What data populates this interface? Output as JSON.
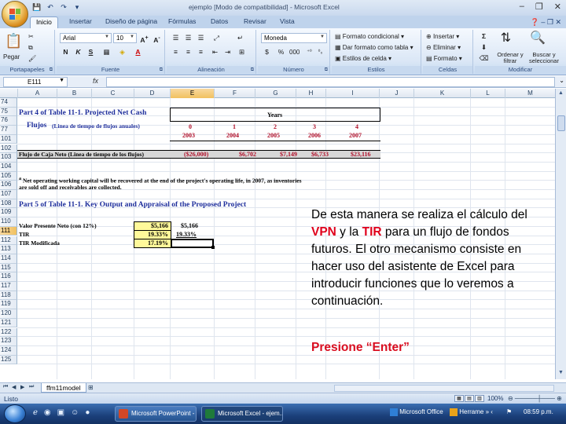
{
  "window": {
    "title": "ejemplo  [Modo de compatibilidad] - Microsoft Excel",
    "controls": [
      "–",
      "❐",
      "✕"
    ]
  },
  "qat": [
    "💾",
    "↶",
    "↷",
    "▾"
  ],
  "ribbon": {
    "tabs": [
      "Inicio",
      "Insertar",
      "Diseño de página",
      "Fórmulas",
      "Datos",
      "Revisar",
      "Vista"
    ],
    "active_tab": "Inicio",
    "help": "❓ – ❐ ✕",
    "clipboard": {
      "label": "Portapapeles",
      "paste": "Pegar"
    },
    "font": {
      "label": "Fuente",
      "name": "Arial",
      "size": "10",
      "bold": "N",
      "italic": "K",
      "underline": "S"
    },
    "alignment": {
      "label": "Alineación"
    },
    "number": {
      "label": "Número",
      "format": "Moneda",
      "thousands": "000"
    },
    "styles": {
      "label": "Estilos",
      "conditional": "Formato condicional",
      "table": "Dar formato como tabla",
      "cell": "Estilos de celda"
    },
    "cells": {
      "label": "Celdas",
      "insert": "Insertar",
      "delete": "Eliminar",
      "format": "Formato"
    },
    "editing": {
      "label": "Modificar",
      "sort": "Ordenar y filtrar",
      "find": "Buscar y seleccionar"
    }
  },
  "formula_bar": {
    "cell_ref": "E111",
    "fx": "fx",
    "content": ""
  },
  "grid": {
    "columns": [
      "A",
      "B",
      "C",
      "D",
      "E",
      "F",
      "G",
      "H",
      "I",
      "J",
      "K",
      "L",
      "M"
    ],
    "selected_column": "E",
    "rows": [
      "74",
      "75",
      "76",
      "77",
      "101",
      "102",
      "103",
      "104",
      "105",
      "106",
      "107",
      "108",
      "109",
      "110",
      "111",
      "112",
      "113",
      "114",
      "115",
      "116",
      "117",
      "118",
      "119",
      "120",
      "121",
      "122",
      "123",
      "124",
      "125"
    ],
    "selected_row": "111",
    "part4_title": "Part 4 of Table 11-1.  Projected Net Cash",
    "years_label": "Years",
    "flujos_label": "Flujos",
    "flujos_sub": "(Linea de tiempo de flujos anuales)",
    "periods": [
      "0",
      "1",
      "2",
      "3",
      "4"
    ],
    "years": [
      "2003",
      "2004",
      "2005",
      "2006",
      "2007"
    ],
    "cashflow_label": "Flujo de Caja Neto (Linea de tiempo de los flujos)",
    "cashflows": [
      "($26,000)",
      "$6,702",
      "$7,149",
      "$6,733",
      "$23,116"
    ],
    "note_line1": "Net operating working capital will be recovered at the end of the project's operating life, in 2007, as inventories",
    "note_marker": "a",
    "note_line2": "are sold off and receivables are collected.",
    "part5_title": "Part 5 of Table 11-1.  Key Output and  Appraisal of the Proposed Project",
    "vpn_label": "Valor Presente Neto (con 12%)",
    "vpn_value": "$5,166",
    "vpn_value_f": "$5,166",
    "tir_label": "TIR",
    "tir_value": "19.33%",
    "tir_value_f": "19.33%",
    "tirm_label": "TIR Modificada",
    "tirm_value": "17.19%"
  },
  "narrative": {
    "part1": "De esta manera se realiza el cálculo del ",
    "vpn": "VPN",
    "part2": " y la ",
    "tir": "TIR",
    "part3": " para un flujo de fondos futuros. El otro mecanismo consiste en hacer uso del asistente de Excel para introducir funciones que lo veremos a continuación.",
    "press_enter": "Presione “Enter”"
  },
  "sheet_tabs": {
    "active": "ffm11model",
    "nav": [
      "⏮",
      "◀",
      "▶",
      "⏭"
    ]
  },
  "status": {
    "text": "Listo",
    "zoom": "100%"
  },
  "taskbar": {
    "tasks": [
      "Microsoft PowerPoint - ...",
      "Microsoft Excel - ejem..."
    ],
    "tray_office": "Microsoft Office",
    "tray_tool": "Herrame",
    "clock": "08:59 p.m."
  },
  "colors": {
    "accent_red": "#e0001b",
    "title_blue": "#1f2f9c",
    "highlight_yellow": "#fff99a"
  }
}
